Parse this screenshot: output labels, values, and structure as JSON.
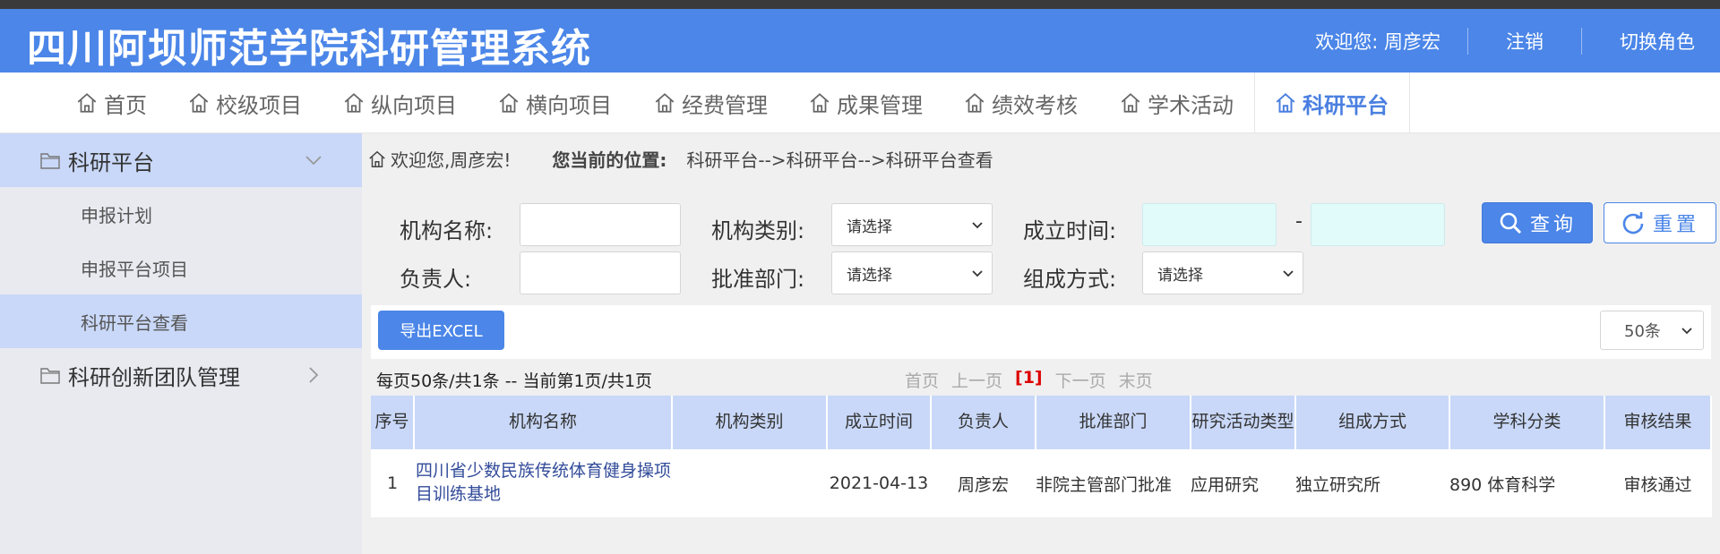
{
  "header": {
    "title": "四川阿坝师范学院科研管理系统",
    "welcome": "欢迎您:  周彦宏",
    "logout": "注销",
    "switch_role": "切换角色"
  },
  "nav": {
    "items": [
      {
        "label": "首页"
      },
      {
        "label": "校级项目"
      },
      {
        "label": "纵向项目"
      },
      {
        "label": "横向项目"
      },
      {
        "label": "经费管理"
      },
      {
        "label": "成果管理"
      },
      {
        "label": "绩效考核"
      },
      {
        "label": "学术活动"
      },
      {
        "label": "科研平台",
        "active": true
      }
    ]
  },
  "sidebar": {
    "group1": "科研平台",
    "subs": [
      "申报计划",
      "申报平台项目",
      "科研平台查看"
    ],
    "group2": "科研创新团队管理"
  },
  "breadcrumb": {
    "greeting": "欢迎您,周彦宏!",
    "position_label": "您当前的位置:",
    "path": "科研平台-->科研平台-->科研平台查看"
  },
  "filters": {
    "org_name_label": "机构名称:",
    "org_type_label": "机构类别:",
    "org_type_value": "请选择",
    "est_time_label": "成立时间:",
    "range_sep": "-",
    "leader_label": "负责人:",
    "approve_dept_label": "批准部门:",
    "approve_dept_value": "请选择",
    "compose_label": "组成方式:",
    "compose_value": "请选择",
    "query": "查询",
    "reset": "重置"
  },
  "toolbar": {
    "export": "导出EXCEL",
    "page_size": "50条"
  },
  "pagination": {
    "info": "每页50条/共1条 -- 当前第1页/共1页",
    "first": "首页",
    "prev": "上一页",
    "current": "[1]",
    "next": "下一页",
    "last": "末页"
  },
  "table": {
    "headers": [
      "序号",
      "机构名称",
      "机构类别",
      "成立时间",
      "负责人",
      "批准部门",
      "研究活动类型",
      "组成方式",
      "学科分类",
      "审核结果"
    ],
    "rows": [
      {
        "idx": "1",
        "name": "四川省少数民族传统体育健身操项目训练基地",
        "type": "",
        "date": "2021-04-13",
        "leader": "周彦宏",
        "dept": "非院主管部门批准",
        "activity": "应用研究",
        "compose": "独立研究所",
        "discipline": "890 体育科学",
        "result": "审核通过"
      }
    ]
  },
  "colors": {
    "brand": "#4b86e8",
    "highlight": "#c9d8f8",
    "date_field": "#e1fbfb"
  }
}
